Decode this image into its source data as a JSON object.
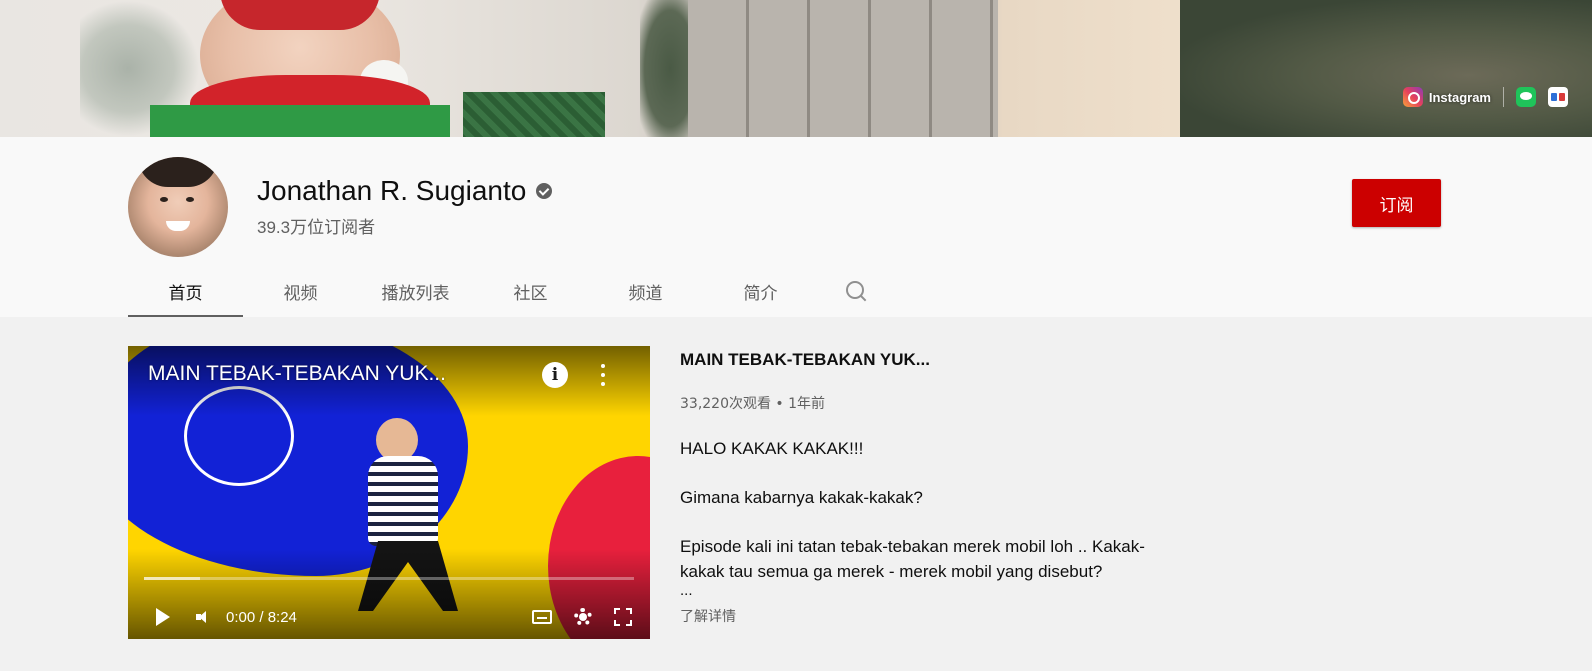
{
  "banner": {
    "links": [
      {
        "label": "Instagram",
        "icon": "instagram-icon"
      },
      {
        "label": "",
        "icon": "line-icon"
      },
      {
        "label": "",
        "icon": "link-icon"
      }
    ]
  },
  "channel": {
    "name": "Jonathan R. Sugianto",
    "verified": true,
    "subscribers": "39.3万位订阅者",
    "subscribe_label": "订阅",
    "subscribe_color": "#cc0000"
  },
  "tabs": [
    {
      "label": "首页",
      "active": true
    },
    {
      "label": "视频",
      "active": false
    },
    {
      "label": "播放列表",
      "active": false
    },
    {
      "label": "社区",
      "active": false
    },
    {
      "label": "频道",
      "active": false
    },
    {
      "label": "简介",
      "active": false
    }
  ],
  "featured_video": {
    "player_title": "MAIN TEBAK-TEBAKAN YUK...",
    "time": "0:00 / 8:24",
    "progress": 0.115,
    "title": "MAIN TEBAK-TEBAKAN YUK...",
    "meta": "33,220次观看 • 1年前",
    "description": [
      "HALO KAKAK KAKAK!!!",
      "Gimana kabarnya kakak-kakak?",
      "Episode kali ini tatan tebak-tebakan merek mobil loh .. Kakak-kakak tau semua ga merek - merek mobil yang disebut?"
    ],
    "ellipsis": "...",
    "more_label": "了解详情"
  }
}
